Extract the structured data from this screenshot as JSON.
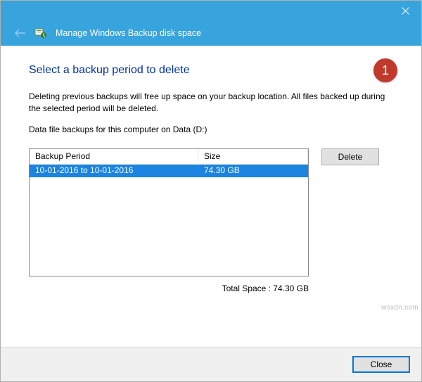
{
  "window": {
    "title": "Manage Windows Backup disk space"
  },
  "annotation": {
    "number": "1"
  },
  "main": {
    "heading": "Select a backup period to delete",
    "description": "Deleting previous backups will free up space on your backup location. All files backed up during the selected period will be deleted.",
    "subdesc": "Data file backups for this computer on Data (D:)"
  },
  "table": {
    "columns": {
      "period": "Backup Period",
      "size": "Size"
    },
    "rows": [
      {
        "period": "10-01-2016 to 10-01-2016",
        "size": "74.30 GB",
        "selected": true
      }
    ],
    "total_label": "Total Space : 74.30 GB"
  },
  "buttons": {
    "delete": "Delete",
    "close": "Close"
  },
  "watermark": "wsxdn.com"
}
